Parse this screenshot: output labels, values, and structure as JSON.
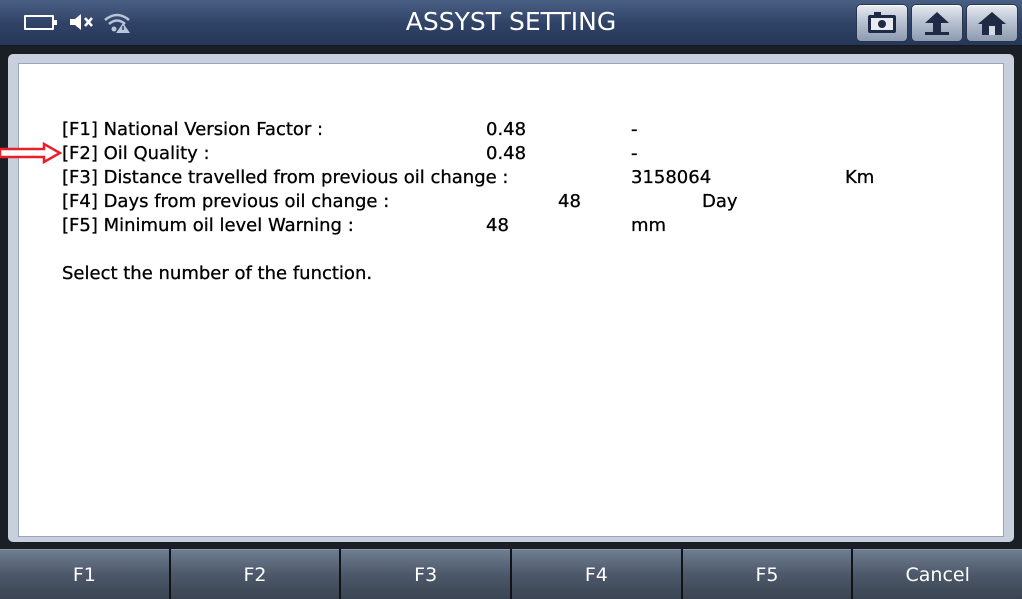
{
  "header": {
    "title": "ASSYST SETTING",
    "icons": [
      "battery-icon",
      "mute-icon",
      "wifi-alert-icon",
      "screenshot-icon",
      "back-icon",
      "home-icon"
    ]
  },
  "rows": [
    {
      "key": "[F1] National Version Factor :",
      "value": "0.48",
      "unit": "-"
    },
    {
      "key": "[F2] Oil Quality :",
      "value": "0.48",
      "unit": "-"
    },
    {
      "key": "[F3] Distance travelled from previous oil change :",
      "value": "3158064",
      "unit": "Km"
    },
    {
      "key": "[F4] Days from previous oil change :",
      "value": "48",
      "unit": "Day"
    },
    {
      "key": "[F5] Minimum oil level Warning :",
      "value": "48",
      "unit": "mm"
    }
  ],
  "prompt": "Select the number of the function.",
  "function_keys": [
    "F1",
    "F2",
    "F3",
    "F4",
    "F5",
    "Cancel"
  ],
  "colors": {
    "header_bg": "#2f4266",
    "panel_bg": "#ffffff",
    "arrow": "#e8202a",
    "key_bg": "#4d596a"
  }
}
